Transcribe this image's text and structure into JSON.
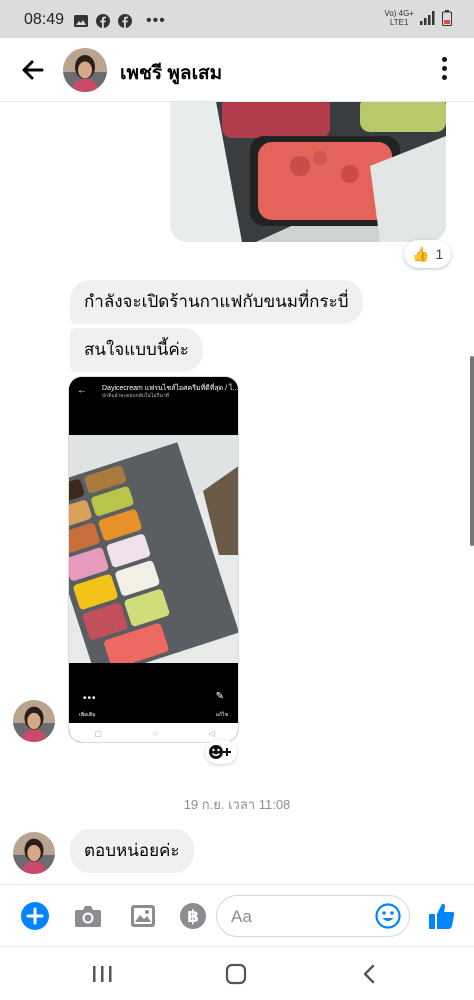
{
  "status_bar": {
    "time": "08:49",
    "network": "Vo) 4G+",
    "lte": "LTE1"
  },
  "header": {
    "contact_name": "เพชรี พูลเสม"
  },
  "chat": {
    "sent_photo_reaction": {
      "emoji": "👍",
      "count": "1"
    },
    "messages": [
      {
        "text": "กำลังจะเปิดร้านกาแฟกับขนมที่กระบี่"
      },
      {
        "text": "สนใจแบบนี้ค่ะ"
      },
      {
        "text": "ตอบหน่อยค่ะ"
      }
    ],
    "shared_image": {
      "title": "Dayicecream แฟรนไชส์ไอศครีมที่ดีที่สุด / ไ...",
      "subtitle": "ปกติแล้วจะตอบกลับในไม่กี่นาที",
      "more_label": "เพิ่มเติม",
      "edit_label": "แก้ไข"
    },
    "timestamp": "19 ก.ย. เวลา 11:08"
  },
  "composer": {
    "placeholder": "Aa"
  },
  "colors": {
    "messenger_blue": "#0084ff",
    "bubble_gray": "#f0f0f0",
    "icon_gray": "#8a8d91"
  },
  "icons": [
    "back-arrow-icon",
    "more-vertical-icon",
    "plus-icon",
    "camera-icon",
    "gallery-icon",
    "baht-icon",
    "emoji-icon",
    "thumbs-up-icon",
    "recent-apps-icon",
    "home-icon",
    "back-nav-icon"
  ]
}
